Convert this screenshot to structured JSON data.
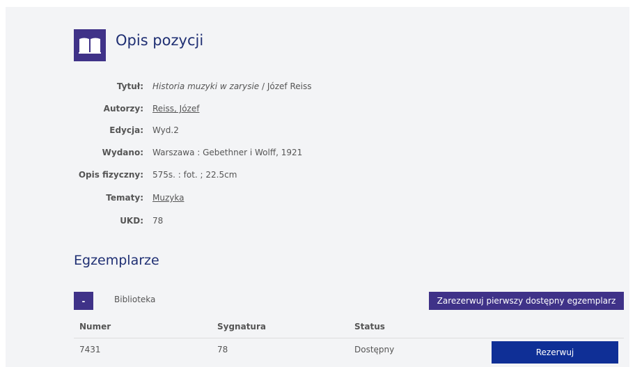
{
  "header": {
    "icon": "book-icon",
    "title": "Opis pozycji"
  },
  "details": {
    "title": {
      "label": "Tytuł:",
      "value_italic": "Historia muzyki w zarysie",
      "value_rest": " / Józef Reiss"
    },
    "authors": {
      "label": "Autorzy:",
      "value": "Reiss, Józef"
    },
    "edition": {
      "label": "Edycja:",
      "value": "Wyd.2"
    },
    "published": {
      "label": "Wydano:",
      "value": "Warszawa : Gebethner i Wolff, 1921"
    },
    "physical": {
      "label": "Opis fizyczny:",
      "value": "575s. : fot. ; 22.5cm"
    },
    "subjects": {
      "label": "Tematy:",
      "value": "Muzyka"
    },
    "ukd": {
      "label": "UKD:",
      "value": "78"
    }
  },
  "copies": {
    "title": "Egzemplarze",
    "toggle_label": "-",
    "library_label": "Biblioteka",
    "reserve_first_label": "Zarezerwuj pierwszy dostępny egzemplarz",
    "columns": [
      "Numer",
      "Sygnatura",
      "Status"
    ],
    "rows": [
      {
        "number": "7431",
        "signature": "78",
        "status": "Dostępny",
        "action": "Rezerwuj"
      }
    ]
  },
  "colors": {
    "accent": "#3f3288",
    "button_blue": "#0f2f96",
    "title_blue": "#1f2f73"
  }
}
